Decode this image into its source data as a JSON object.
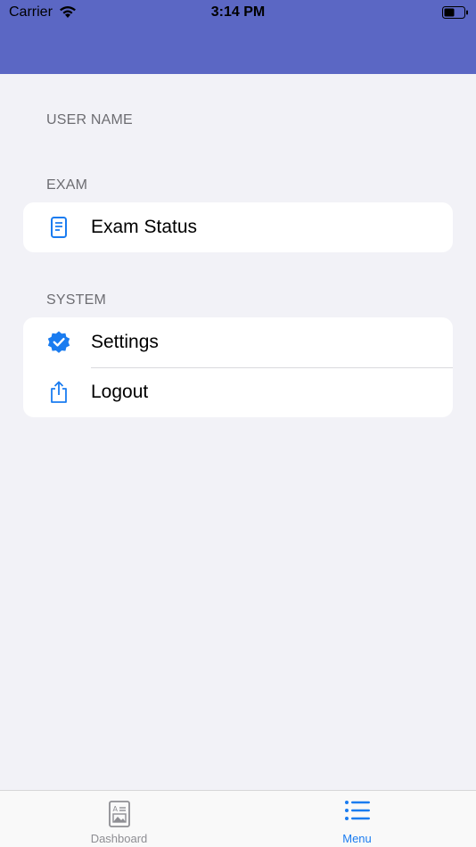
{
  "status_bar": {
    "carrier": "Carrier",
    "time": "3:14 PM",
    "wifi_icon": "wifi-icon",
    "battery_icon": "battery-icon"
  },
  "colors": {
    "header": "#5b67c4",
    "accent": "#1a7cf0",
    "background": "#f2f2f7"
  },
  "user": {
    "section_label": "USER NAME"
  },
  "exam": {
    "section_label": "EXAM",
    "items": [
      {
        "label": "Exam Status",
        "icon": "document-icon"
      }
    ]
  },
  "system": {
    "section_label": "SYSTEM",
    "items": [
      {
        "label": "Settings",
        "icon": "verified-badge-icon"
      },
      {
        "label": "Logout",
        "icon": "share-icon"
      }
    ]
  },
  "tab_bar": {
    "tabs": [
      {
        "label": "Dashboard",
        "icon": "dashboard-icon",
        "active": false
      },
      {
        "label": "Menu",
        "icon": "list-icon",
        "active": true
      }
    ]
  }
}
